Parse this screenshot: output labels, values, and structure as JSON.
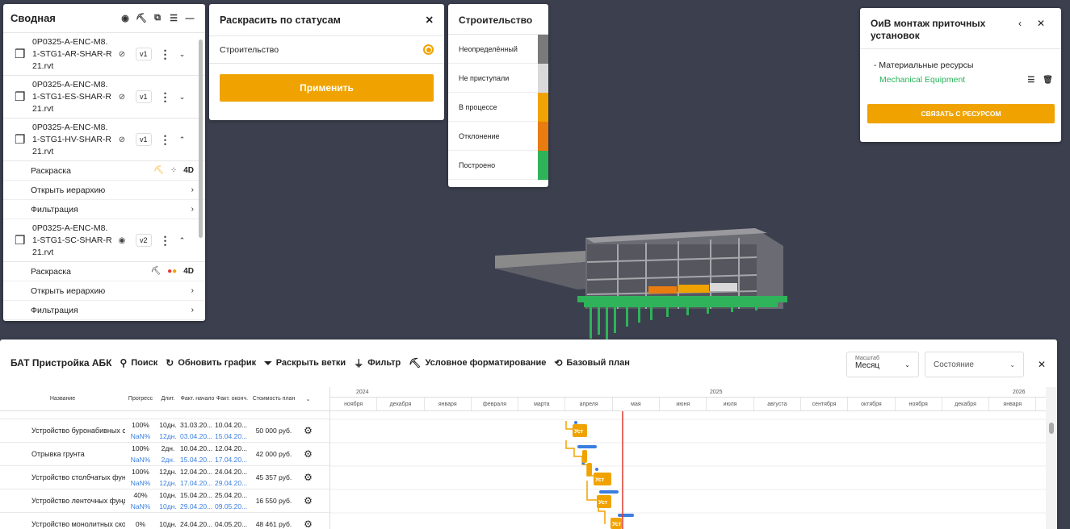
{
  "svodnaya": {
    "title": "Сводная",
    "models": [
      {
        "name_l1": "0P0325-A-ENC-M8.",
        "name_l2": "1-STG1-AR-SHAR-R",
        "name_l3": "21.rvt",
        "version": "v1",
        "visibility": "hidden",
        "chevron": "down"
      },
      {
        "name_l1": "0P0325-A-ENC-M8.",
        "name_l2": "1-STG1-ES-SHAR-R",
        "name_l3": "21.rvt",
        "version": "v1",
        "visibility": "hidden",
        "chevron": "down"
      },
      {
        "name_l1": "0P0325-A-ENC-M8.",
        "name_l2": "1-STG1-HV-SHAR-R",
        "name_l3": "21.rvt",
        "version": "v1",
        "visibility": "hidden",
        "chevron": "up"
      },
      {
        "name_l1": "0P0325-A-ENC-M8.",
        "name_l2": "1-STG1-SC-SHAR-R",
        "name_l3": "21.rvt",
        "version": "v2",
        "visibility": "visible",
        "chevron": "up"
      }
    ],
    "coloring": "Раскраска",
    "open_hierarchy": "Открыть иерархию",
    "filtration": "Фильтрация",
    "badge_4d": "4D"
  },
  "color_by_status": {
    "title": "Раскрасить по статусам",
    "option": "Строительство",
    "apply": "Применить"
  },
  "legend": {
    "title": "Строительство",
    "items": [
      {
        "label": "Неопределённый",
        "color": "#7a7a7a"
      },
      {
        "label": "Не приступали",
        "color": "#d9d9d9"
      },
      {
        "label": "В процессе",
        "color": "#f0a300"
      },
      {
        "label": "Отклонение",
        "color": "#e87c10"
      },
      {
        "label": "Построено",
        "color": "#2fb35a"
      }
    ]
  },
  "resource_panel": {
    "title": "ОиВ монтаж приточных установок",
    "material": "- Материальные ресурсы",
    "item": "Mechanical Equipment",
    "link_button": "СВЯЗАТЬ С РЕСУРСОМ"
  },
  "gantt": {
    "title": "БАТ Пристройка АБК",
    "toolbar": {
      "search": "Поиск",
      "refresh": "Обновить график",
      "expand": "Раскрыть ветки",
      "filter": "Фильтр",
      "cond_format": "Условное форматирование",
      "baseline": "Базовый план"
    },
    "scale_label": "Масштаб",
    "scale_value": "Месяц",
    "state_placeholder": "Состояние",
    "columns": {
      "name": "Название",
      "progress": "Прогресс",
      "duration": "Длит.",
      "fact_start": "Факт. начало",
      "fact_end": "Факт. оконч.",
      "cost": "Стоимость план",
      "fx": "fx"
    },
    "rows": [
      {
        "name": "Устройство буронабивных св",
        "progress": "100%",
        "progress2": "NaN%",
        "dur": "10дн.",
        "dur2": "12дн.",
        "fs": "31.03.20...",
        "fs2": "03.04.20...",
        "fe": "10.04.20...",
        "fe2": "15.04.20...",
        "cost": "50 000 руб."
      },
      {
        "name": "Отрывка грунта",
        "progress": "100%",
        "progress2": "NaN%",
        "dur": "2дн.",
        "dur2": "2дн.",
        "fs": "10.04.20...",
        "fs2": "15.04.20...",
        "fe": "12.04.20...",
        "fe2": "17.04.20...",
        "cost": "42 000 руб."
      },
      {
        "name": "Устройство столбчатых фунд",
        "progress": "100%",
        "progress2": "NaN%",
        "dur": "12дн.",
        "dur2": "12дн.",
        "fs": "12.04.20...",
        "fs2": "17.04.20...",
        "fe": "24.04.20...",
        "fe2": "29.04.20...",
        "cost": "45 357 руб."
      },
      {
        "name": "Устройство ленточных фунд",
        "progress": "40%",
        "progress2": "NaN%",
        "dur": "10дн.",
        "dur2": "10дн.",
        "fs": "15.04.20...",
        "fs2": "29.04.20...",
        "fe": "25.04.20...",
        "fe2": "09.05.20...",
        "cost": "16 550 руб."
      },
      {
        "name": "Устройство монолитных ско",
        "progress": "0%",
        "progress2": "",
        "dur": "10дн.",
        "dur2": "",
        "fs": "24.04.20...",
        "fs2": "",
        "fe": "04.05.20...",
        "fe2": "",
        "cost": "48 461 руб."
      }
    ],
    "years": [
      "2024",
      "2025",
      "2026"
    ],
    "months": [
      "ноября",
      "декабря",
      "января",
      "февраля",
      "марта",
      "апреля",
      "мая",
      "июня",
      "июля",
      "августа",
      "сентября",
      "октября",
      "ноября",
      "декабря",
      "января"
    ],
    "bar_label": "Уст"
  }
}
